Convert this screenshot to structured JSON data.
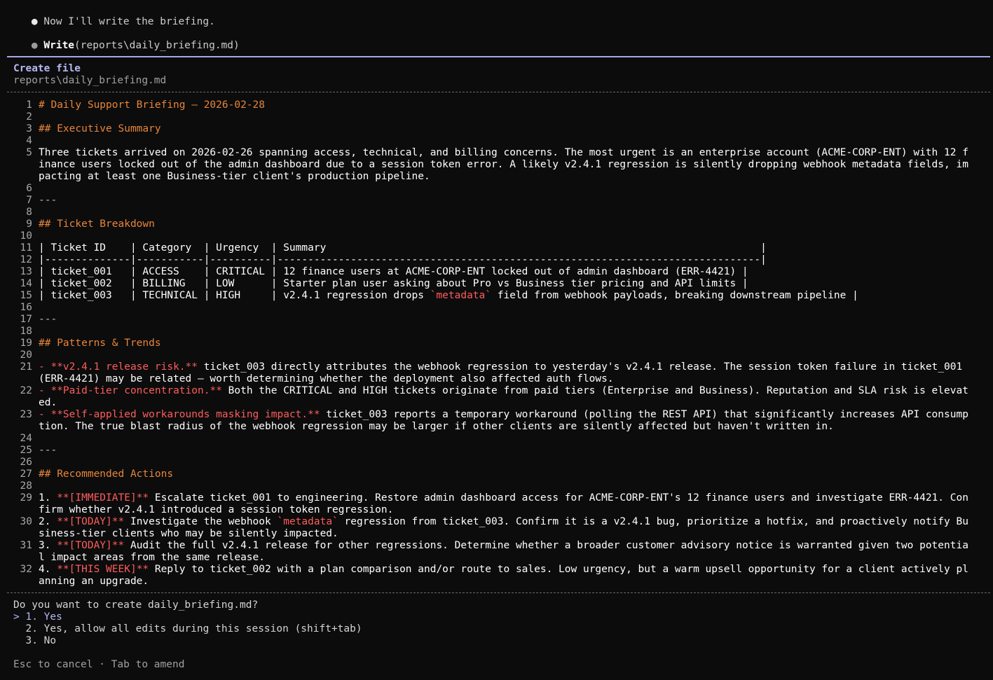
{
  "messages": [
    {
      "bullet": "●",
      "text": "Now I'll write the briefing."
    },
    {
      "bullet": "●",
      "tool": "Write",
      "args": "(reports\\daily_briefing.md)"
    }
  ],
  "create_panel": {
    "title": "Create file",
    "path": "reports\\daily_briefing.md"
  },
  "file_lines": [
    {
      "n": "1",
      "segs": [
        {
          "t": "# Daily Support Briefing — 2026-02-28",
          "c": "hd"
        }
      ]
    },
    {
      "n": "2",
      "segs": []
    },
    {
      "n": "3",
      "segs": [
        {
          "t": "## Executive Summary",
          "c": "hd"
        }
      ]
    },
    {
      "n": "4",
      "segs": []
    },
    {
      "n": "5",
      "segs": [
        {
          "t": "Three tickets arrived on 2026-02-26 spanning access, technical, and billing concerns. The most urgent is an enterprise account (ACME-CORP-ENT) with 12 finance users locked out of the admin dashboard due to a session token error. A likely v2.4.1 regression is silently dropping webhook metadata fields, impacting at least one Business-tier client's production pipeline.",
          "c": ""
        }
      ]
    },
    {
      "n": "6",
      "segs": []
    },
    {
      "n": "7",
      "segs": [
        {
          "t": "---",
          "c": "dim"
        }
      ]
    },
    {
      "n": "8",
      "segs": []
    },
    {
      "n": "9",
      "segs": [
        {
          "t": "## Ticket Breakdown",
          "c": "hd"
        }
      ]
    },
    {
      "n": "10",
      "segs": []
    },
    {
      "n": "11",
      "segs": [
        {
          "t": "| Ticket ID    | Category  | Urgency  | Summary                                                                       |",
          "c": ""
        }
      ]
    },
    {
      "n": "12",
      "segs": [
        {
          "t": "|--------------|-----------|----------|-------------------------------------------------------------------------------|",
          "c": ""
        }
      ]
    },
    {
      "n": "13",
      "segs": [
        {
          "t": "| ticket_001   | ACCESS    | CRITICAL | 12 finance users at ACME-CORP-ENT locked out of admin dashboard (ERR-4421) |",
          "c": ""
        }
      ]
    },
    {
      "n": "14",
      "segs": [
        {
          "t": "| ticket_002   | BILLING   | LOW      | Starter plan user asking about Pro vs Business tier pricing and API limits |",
          "c": ""
        }
      ]
    },
    {
      "n": "15",
      "segs": [
        {
          "t": "| ticket_003   | TECHNICAL | HIGH     | v2.4.1 regression drops ",
          "c": ""
        },
        {
          "t": "`metadata`",
          "c": "red"
        },
        {
          "t": " field from webhook payloads, breaking downstream pipeline |",
          "c": ""
        }
      ]
    },
    {
      "n": "16",
      "segs": []
    },
    {
      "n": "17",
      "segs": [
        {
          "t": "---",
          "c": "dim"
        }
      ]
    },
    {
      "n": "18",
      "segs": []
    },
    {
      "n": "19",
      "segs": [
        {
          "t": "## Patterns & Trends",
          "c": "hd"
        }
      ]
    },
    {
      "n": "20",
      "segs": []
    },
    {
      "n": "21",
      "segs": [
        {
          "t": "- ",
          "c": "red"
        },
        {
          "t": "**v2.4.1 release risk.**",
          "c": "red"
        },
        {
          "t": " ticket_003 directly attributes the webhook regression to yesterday's v2.4.1 release. The session token failure in ticket_001 (ERR-4421) may be related — worth determining whether the deployment also affected auth flows.",
          "c": ""
        }
      ]
    },
    {
      "n": "22",
      "segs": [
        {
          "t": "- ",
          "c": "red"
        },
        {
          "t": "**Paid-tier concentration.**",
          "c": "red"
        },
        {
          "t": " Both the CRITICAL and HIGH tickets originate from paid tiers (Enterprise and Business). Reputation and SLA risk is elevated.",
          "c": ""
        }
      ]
    },
    {
      "n": "23",
      "segs": [
        {
          "t": "- ",
          "c": "red"
        },
        {
          "t": "**Self-applied workarounds masking impact.**",
          "c": "red"
        },
        {
          "t": " ticket_003 reports a temporary workaround (polling the REST API) that significantly increases API consumption. The true blast radius of the webhook regression may be larger if other clients are silently affected but haven't written in.",
          "c": ""
        }
      ]
    },
    {
      "n": "24",
      "segs": []
    },
    {
      "n": "25",
      "segs": [
        {
          "t": "---",
          "c": "dim"
        }
      ]
    },
    {
      "n": "26",
      "segs": []
    },
    {
      "n": "27",
      "segs": [
        {
          "t": "## Recommended Actions",
          "c": "hd"
        }
      ]
    },
    {
      "n": "28",
      "segs": []
    },
    {
      "n": "29",
      "segs": [
        {
          "t": "1. ",
          "c": ""
        },
        {
          "t": "**[IMMEDIATE]**",
          "c": "red"
        },
        {
          "t": " Escalate ticket_001 to engineering. Restore admin dashboard access for ACME-CORP-ENT's 12 finance users and investigate ERR-4421. Confirm whether v2.4.1 introduced a session token regression.",
          "c": ""
        }
      ]
    },
    {
      "n": "30",
      "segs": [
        {
          "t": "2. ",
          "c": ""
        },
        {
          "t": "**[TODAY]**",
          "c": "red"
        },
        {
          "t": " Investigate the webhook ",
          "c": ""
        },
        {
          "t": "`metadata`",
          "c": "red"
        },
        {
          "t": " regression from ticket_003. Confirm it is a v2.4.1 bug, prioritize a hotfix, and proactively notify Business-tier clients who may be silently impacted.",
          "c": ""
        }
      ]
    },
    {
      "n": "31",
      "segs": [
        {
          "t": "3. ",
          "c": ""
        },
        {
          "t": "**[TODAY]**",
          "c": "red"
        },
        {
          "t": " Audit the full v2.4.1 release for other regressions. Determine whether a broader customer advisory notice is warranted given two potential impact areas from the same release.",
          "c": ""
        }
      ]
    },
    {
      "n": "32",
      "segs": [
        {
          "t": "4. ",
          "c": ""
        },
        {
          "t": "**[THIS WEEK]**",
          "c": "red"
        },
        {
          "t": " Reply to ticket_002 with a plan comparison and/or route to sales. Low urgency, but a warm upsell opportunity for a client actively planning an upgrade.",
          "c": ""
        }
      ]
    }
  ],
  "prompt": {
    "question": "Do you want to create daily_briefing.md?",
    "options": [
      {
        "marker": ">",
        "label": "1. Yes",
        "selected": true
      },
      {
        "marker": " ",
        "label": "2. Yes, allow all edits during this session (shift+tab)",
        "selected": false
      },
      {
        "marker": " ",
        "label": "3. No",
        "selected": false
      }
    ]
  },
  "footer": "Esc to cancel · Tab to amend",
  "colors": {
    "background": "#0c0c0c",
    "heading": "#e8853a",
    "accent": "#b4b8f2",
    "emphasis": "#ff5c5c"
  }
}
